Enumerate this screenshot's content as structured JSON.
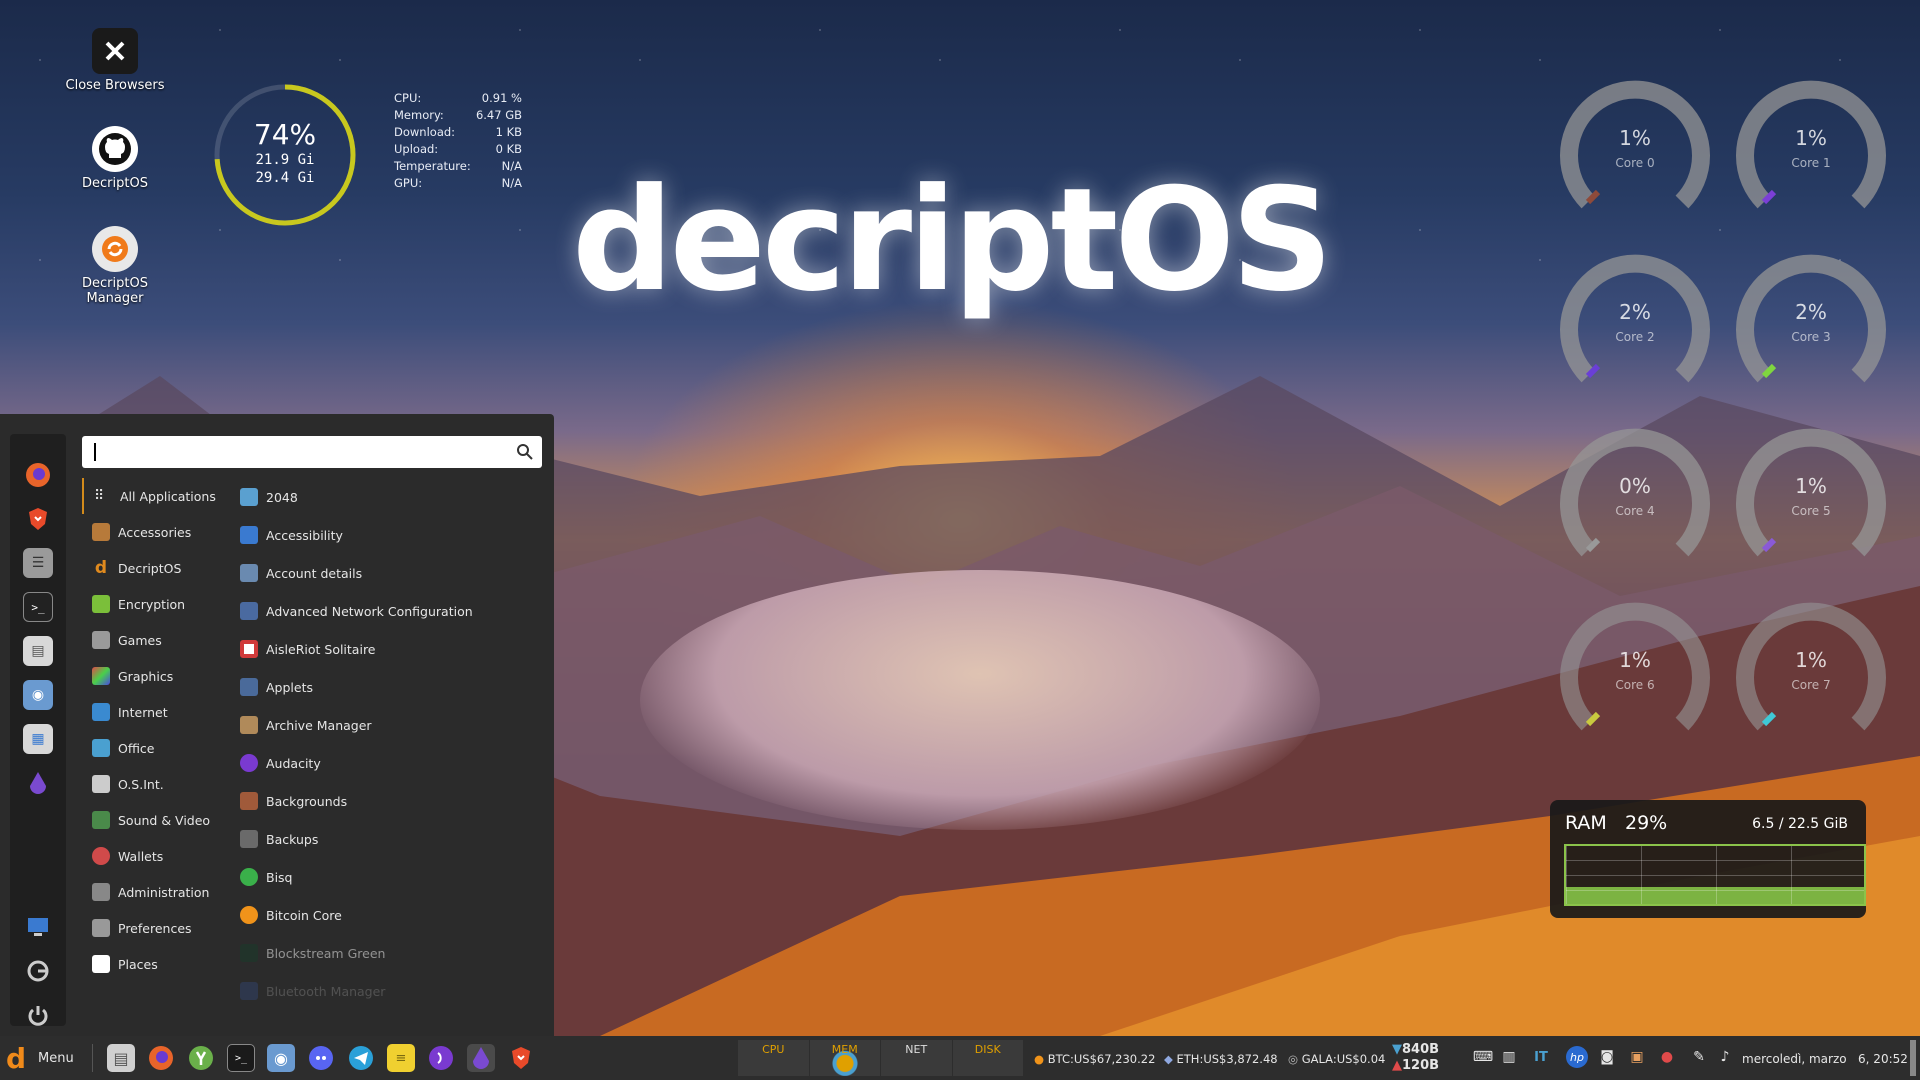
{
  "brand": {
    "text": "decriptOS"
  },
  "desktop_icons": [
    {
      "label": "Close Browsers",
      "icon": "close-icon"
    },
    {
      "label": "DecriptOS",
      "icon": "github-icon"
    },
    {
      "label": "DecriptOS Manager",
      "icon": "refresh-icon"
    }
  ],
  "conky": {
    "memory_percent": "74%",
    "mem_used": "21.9 Gi",
    "mem_total": "29.4 Gi",
    "gauge_fraction": 0.74,
    "rows": [
      {
        "label": "CPU:",
        "value": "0.91 %"
      },
      {
        "label": "Memory:",
        "value": "6.47 GB"
      },
      {
        "label": "Download:",
        "value": "1 KB"
      },
      {
        "label": "Upload:",
        "value": "0 KB"
      },
      {
        "label": "Temperature:",
        "value": "N/A"
      },
      {
        "label": "GPU:",
        "value": "N/A"
      }
    ]
  },
  "cores": [
    {
      "pct": "1%",
      "label": "Core 0",
      "color": "#8e4a3a"
    },
    {
      "pct": "1%",
      "label": "Core 1",
      "color": "#7b3fd6"
    },
    {
      "pct": "2%",
      "label": "Core 2",
      "color": "#6a3fd6"
    },
    {
      "pct": "2%",
      "label": "Core 3",
      "color": "#7fd63f"
    },
    {
      "pct": "0%",
      "label": "Core 4",
      "color": "#999999"
    },
    {
      "pct": "1%",
      "label": "Core 5",
      "color": "#8a5ad6"
    },
    {
      "pct": "1%",
      "label": "Core 6",
      "color": "#c9c93f"
    },
    {
      "pct": "1%",
      "label": "Core 7",
      "color": "#3fc9d6"
    }
  ],
  "ram": {
    "title": "RAM",
    "percent": "29%",
    "used": "6.5 / 22.5 GiB",
    "fraction": 0.29
  },
  "menu": {
    "search_placeholder": "",
    "categories": [
      {
        "label": "All Applications",
        "color": "#dddddd",
        "active": true
      },
      {
        "label": "Accessories",
        "color": "#b77a3a"
      },
      {
        "label": "DecriptOS",
        "color": "#e08a1e"
      },
      {
        "label": "Encryption",
        "color": "#7bbf3a"
      },
      {
        "label": "Games",
        "color": "#9a9a9a"
      },
      {
        "label": "Graphics",
        "color": "#d04aa0"
      },
      {
        "label": "Internet",
        "color": "#3a8ad0"
      },
      {
        "label": "Office",
        "color": "#4aa0d0"
      },
      {
        "label": "O.S.Int.",
        "color": "#cccccc"
      },
      {
        "label": "Sound & Video",
        "color": "#4a8a4a"
      },
      {
        "label": "Wallets",
        "color": "#d04a4a"
      },
      {
        "label": "Administration",
        "color": "#888888"
      },
      {
        "label": "Preferences",
        "color": "#999999"
      },
      {
        "label": "Places",
        "color": "#ffffff"
      }
    ],
    "apps": [
      {
        "label": "2048",
        "color": "#5aa0d0"
      },
      {
        "label": "Accessibility",
        "color": "#3a7ad0"
      },
      {
        "label": "Account details",
        "color": "#6a8ab0"
      },
      {
        "label": "Advanced Network Configuration",
        "color": "#4a6aa0"
      },
      {
        "label": "AisleRiot Solitaire",
        "color": "#d03a3a"
      },
      {
        "label": "Applets",
        "color": "#4a6a9a"
      },
      {
        "label": "Archive Manager",
        "color": "#b08a5a"
      },
      {
        "label": "Audacity",
        "color": "#7a3ad0"
      },
      {
        "label": "Backgrounds",
        "color": "#a05a3a"
      },
      {
        "label": "Backups",
        "color": "#6a6a6a"
      },
      {
        "label": "Bisq",
        "color": "#3ab04a"
      },
      {
        "label": "Bitcoin Core",
        "color": "#f0931a"
      },
      {
        "label": "Blockstream Green",
        "color": "#1a3a2a"
      },
      {
        "label": "Bluetooth Manager",
        "color": "#3a6ad0"
      }
    ]
  },
  "favorites": [
    {
      "icon": "firefox-icon",
      "color": "#e8642a"
    },
    {
      "icon": "brave-icon",
      "color": "#e84a2a"
    },
    {
      "icon": "settings-sliders-icon",
      "color": "#9a9a9a"
    },
    {
      "icon": "terminal-icon",
      "color": "#222222"
    },
    {
      "icon": "files-icon",
      "color": "#d8d8d8"
    },
    {
      "icon": "disk-utility-icon",
      "color": "#6a9ad0"
    },
    {
      "icon": "apps-grid-icon",
      "color": "#d8d8d8"
    },
    {
      "icon": "tor-icon",
      "color": "#7a4ad0"
    },
    {
      "icon": "system-monitor-icon",
      "color": "#3a7ad0"
    },
    {
      "icon": "logout-icon",
      "color": "#cccccc"
    },
    {
      "icon": "power-icon",
      "color": "#cccccc"
    }
  ],
  "taskbar": {
    "menu_label": "Menu",
    "apps": [
      {
        "icon": "files-icon",
        "color": "#d0d0d0"
      },
      {
        "icon": "firefox-icon",
        "color": "#e8642a"
      },
      {
        "icon": "keepass-icon",
        "color": "#6ab04a"
      },
      {
        "icon": "terminal-icon",
        "color": "#1a1a1a"
      },
      {
        "icon": "disk-utility-icon",
        "color": "#6a9ad0"
      },
      {
        "icon": "discord-icon",
        "color": "#5865f2"
      },
      {
        "icon": "telegram-icon",
        "color": "#2aa0d8"
      },
      {
        "icon": "notes-icon",
        "color": "#f0d030"
      },
      {
        "icon": "podcast-icon",
        "color": "#7a3ad0"
      },
      {
        "icon": "tor-icon",
        "color": "#7a4ad0",
        "active": true
      },
      {
        "icon": "brave-icon",
        "color": "#e84a2a"
      }
    ],
    "monitors": [
      "CPU",
      "MEM",
      "NET",
      "DISK"
    ],
    "crypto": [
      {
        "text": "BTC:US$67,230.22"
      },
      {
        "text": "ETH:US$3,872.48"
      },
      {
        "text": "GALA:US$0.04"
      }
    ],
    "net_down": "840B",
    "net_up": "120B",
    "layout": "IT",
    "tray": [
      "keyboard-icon",
      "network-icon",
      "layout-indicator",
      "hp-printer-icon",
      "discord-icon",
      "shield-icon",
      "update-icon",
      "pen-icon",
      "music-icon"
    ],
    "clock": "mercoledì, marzo   6, 20:52"
  }
}
